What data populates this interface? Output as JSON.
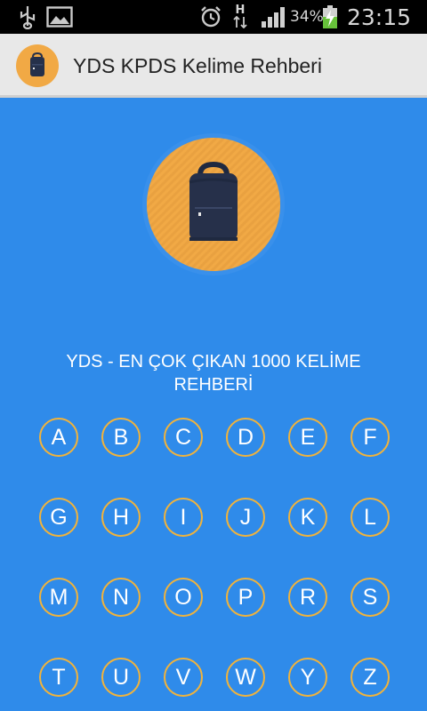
{
  "status_bar": {
    "icons": [
      "usb-icon",
      "image-icon",
      "alarm-icon",
      "data-activity-icon",
      "signal-icon",
      "battery-charging-icon"
    ],
    "network_label": "H",
    "battery_percent": "34%",
    "time": "23:15"
  },
  "app_bar": {
    "icon": "backpack-icon",
    "title": "YDS KPDS Kelime Rehberi"
  },
  "main": {
    "hero_icon": "backpack-icon",
    "subtitle_line1": "YDS - EN ÇOK ÇIKAN 1000 KELİME",
    "subtitle_line2": "REHBERİ",
    "letters": [
      [
        "A",
        "B",
        "C",
        "D",
        "E",
        "F"
      ],
      [
        "G",
        "H",
        "I",
        "J",
        "K",
        "L"
      ],
      [
        "M",
        "N",
        "O",
        "P",
        "R",
        "S"
      ],
      [
        "T",
        "U",
        "V",
        "W",
        "Y",
        "Z"
      ]
    ]
  },
  "colors": {
    "background": "#2f8bea",
    "accent_orange": "#f1a945",
    "button_border": "#f2b33a",
    "app_bar": "#e8e8e8"
  }
}
